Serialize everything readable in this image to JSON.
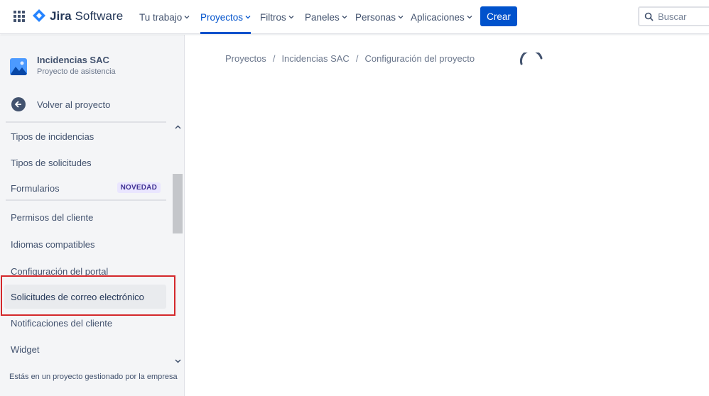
{
  "header": {
    "app_name_bold": "Jira",
    "app_name_rest": " Software",
    "nav": [
      {
        "label": "Tu trabajo"
      },
      {
        "label": "Proyectos"
      },
      {
        "label": "Filtros"
      },
      {
        "label": "Paneles"
      },
      {
        "label": "Personas"
      },
      {
        "label": "Aplicaciones"
      }
    ],
    "create_label": "Crear",
    "search_placeholder": "Buscar",
    "accent_color": "#0052cc"
  },
  "sidebar": {
    "project_name": "Incidencias SAC",
    "project_type": "Proyecto de asistencia",
    "back_label": "Volver al proyecto",
    "items": [
      {
        "label": "Tipos de incidencias"
      },
      {
        "label": "Tipos de solicitudes"
      },
      {
        "label": "Formularios",
        "badge": "NOVEDAD"
      },
      {
        "label": "Permisos del cliente"
      },
      {
        "label": "Idiomas compatibles"
      },
      {
        "label": "Configuración del portal"
      },
      {
        "label": "Solicitudes de correo electrónico",
        "selected": true
      },
      {
        "label": "Notificaciones del cliente"
      },
      {
        "label": "Widget"
      }
    ],
    "footer": "Estás en un proyecto gestionado por la empresa"
  },
  "breadcrumb": {
    "items": [
      "Proyectos",
      "Incidencias SAC",
      "Configuración del proyecto"
    ],
    "separator": "/"
  },
  "highlight_color": "#d4282b"
}
